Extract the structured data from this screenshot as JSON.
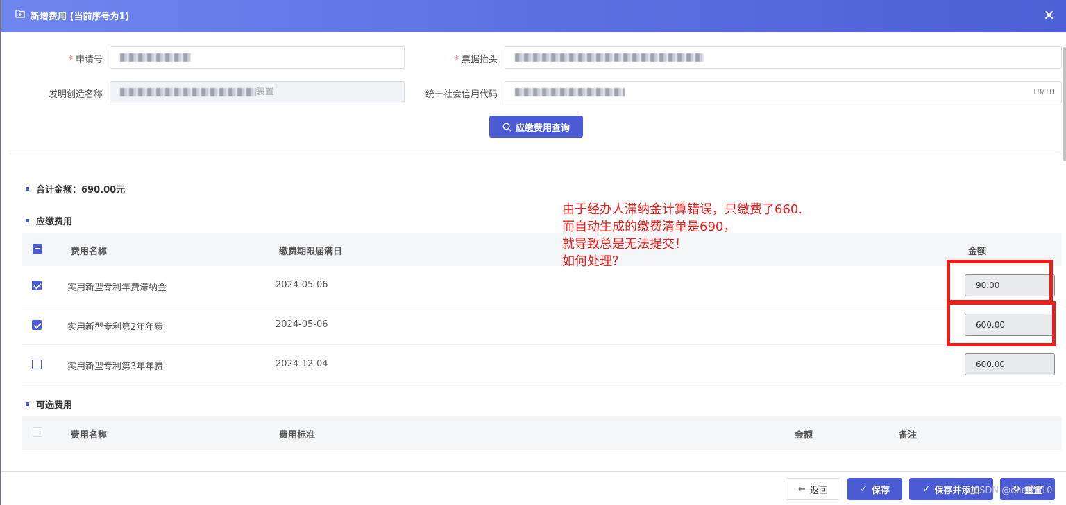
{
  "dialog": {
    "title": "新增费用 (当前序号为1)",
    "close_symbol": "✕"
  },
  "form": {
    "application_no_label": "申请号",
    "invoice_title_label": "票据抬头",
    "invention_name_label": "发明创造名称",
    "invention_name_suffix": "装置",
    "credit_code_label": "统一社会信用代码",
    "credit_code_counter": "18/18",
    "query_button": "应缴费用查询"
  },
  "summary": {
    "total_label": "合计金额：690.00元"
  },
  "payable_fees": {
    "section_title": "应缴费用",
    "columns": [
      "费用名称",
      "缴费期限届满日",
      "金额"
    ],
    "rows": [
      {
        "name": "实用新型专利年费滞纳金",
        "due_date": "2024-05-06",
        "amount": "90.00",
        "checked": true
      },
      {
        "name": "实用新型专利第2年年费",
        "due_date": "2024-05-06",
        "amount": "600.00",
        "checked": true
      },
      {
        "name": "实用新型专利第3年年费",
        "due_date": "2024-12-04",
        "amount": "600.00",
        "checked": false
      }
    ]
  },
  "optional_fees": {
    "section_title": "可选费用",
    "columns": [
      "费用名称",
      "费用标准",
      "金额",
      "备注"
    ]
  },
  "annotation": {
    "text": "由于经办人滞纳金计算错误，只缴费了660.\n而自动生成的缴费清单是690，\n就导致总是无法提交！\n如何处理？",
    "color": "#e8201c"
  },
  "footer": {
    "back": "返回",
    "save": "保存",
    "save_and_add": "保存并添加",
    "reset": "重置"
  },
  "watermark": "CSDN @qilei2010",
  "colors": {
    "primary": "#4a5bd3",
    "required": "#f56c6c"
  }
}
